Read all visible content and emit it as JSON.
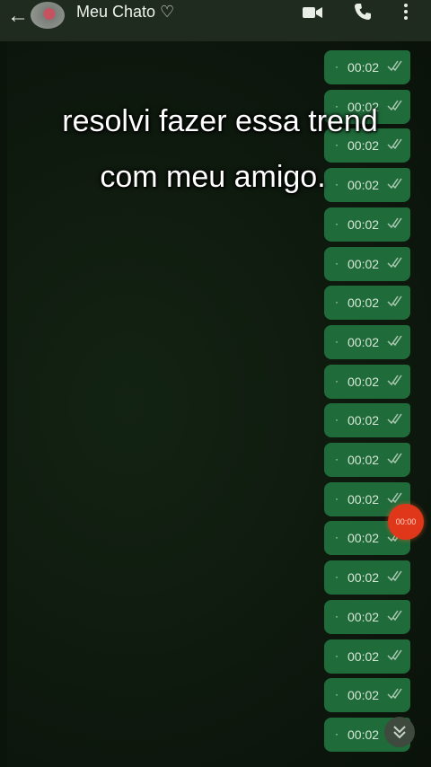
{
  "header": {
    "back_glyph": "←",
    "contact_name": "Meu Chato ♡",
    "icons": [
      "back-arrow-icon",
      "avatar",
      "video-call-icon",
      "phone-call-icon",
      "more-options-icon"
    ]
  },
  "caption": {
    "line1": "resolvi fazer essa trend",
    "line2": "com meu amigo."
  },
  "messages": [
    {
      "dot": "·",
      "time": "00:02"
    },
    {
      "dot": "·",
      "time": "00:02"
    },
    {
      "dot": "·",
      "time": "00:02"
    },
    {
      "dot": "·",
      "time": "00:02"
    },
    {
      "dot": "·",
      "time": "00:02"
    },
    {
      "dot": "·",
      "time": "00:02"
    },
    {
      "dot": "·",
      "time": "00:02"
    },
    {
      "dot": "·",
      "time": "00:02"
    },
    {
      "dot": "·",
      "time": "00:02"
    },
    {
      "dot": "·",
      "time": "00:02"
    },
    {
      "dot": "·",
      "time": "00:02"
    },
    {
      "dot": "·",
      "time": "00:02"
    },
    {
      "dot": "·",
      "time": "00:02"
    },
    {
      "dot": "·",
      "time": "00:02"
    },
    {
      "dot": "·",
      "time": "00:02"
    },
    {
      "dot": "·",
      "time": "00:02"
    },
    {
      "dot": "·",
      "time": "00:02"
    },
    {
      "dot": "·",
      "time": "00:02"
    }
  ],
  "recording": {
    "timer": "00:00"
  },
  "colors": {
    "bubble": "#1f6b3a",
    "record": "#e0361a",
    "header": "#1f2b1e"
  }
}
